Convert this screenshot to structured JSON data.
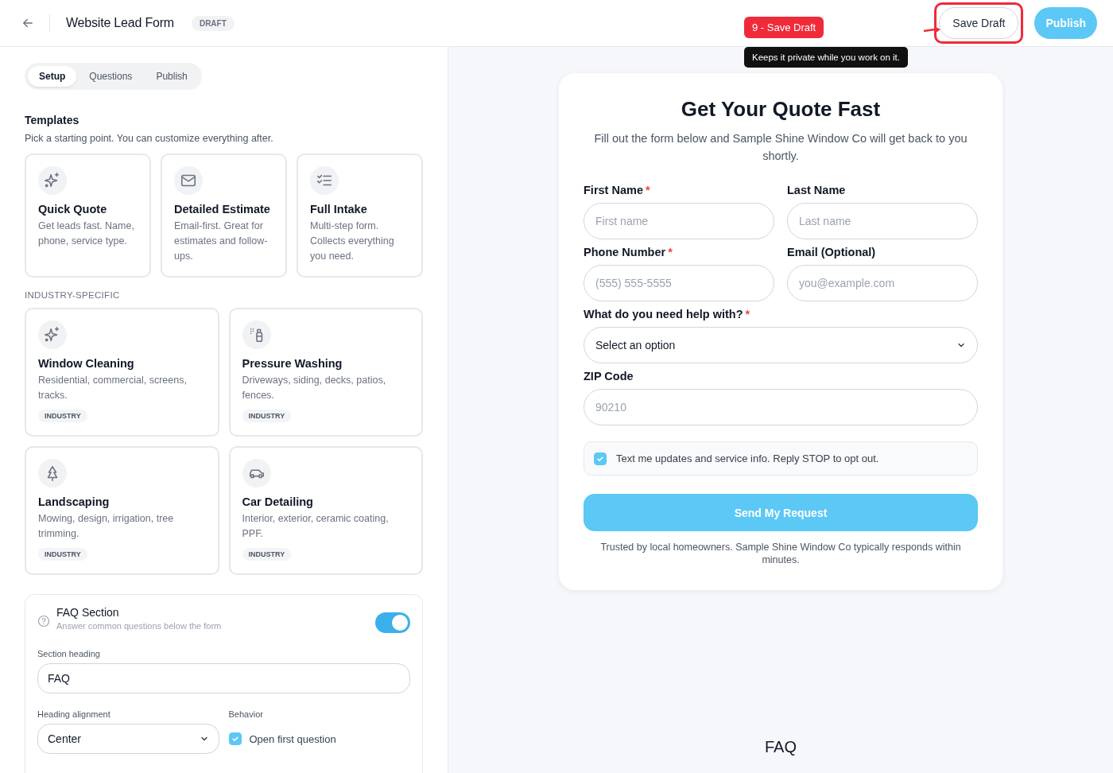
{
  "header": {
    "title": "Website Lead Form",
    "status": "DRAFT",
    "save_label": "Save Draft",
    "publish_label": "Publish"
  },
  "annotation": {
    "badge": "9 - Save Draft",
    "tooltip": "Keeps it private while you work on it."
  },
  "tabs": [
    {
      "label": "Setup",
      "selected": true
    },
    {
      "label": "Questions",
      "selected": false
    },
    {
      "label": "Publish",
      "selected": false
    }
  ],
  "templates": {
    "title": "Templates",
    "subtitle": "Pick a starting point. You can customize everything after.",
    "items": [
      {
        "title": "Quick Quote",
        "description": "Get leads fast. Name, phone, service type."
      },
      {
        "title": "Detailed Estimate",
        "description": "Email-first. Great for estimates and follow-ups."
      },
      {
        "title": "Full Intake",
        "description": "Multi-step form. Collects everything you need."
      }
    ]
  },
  "industry": {
    "title": "INDUSTRY-SPECIFIC",
    "items": [
      {
        "title": "Window Cleaning",
        "description": "Residential, commercial, screens, tracks.",
        "tag": "INDUSTRY"
      },
      {
        "title": "Pressure Washing",
        "description": "Driveways, siding, decks, patios, fences.",
        "tag": "INDUSTRY"
      },
      {
        "title": "Landscaping",
        "description": "Mowing, design, irrigation, tree trimming.",
        "tag": "INDUSTRY"
      },
      {
        "title": "Car Detailing",
        "description": "Interior, exterior, ceramic coating, PPF.",
        "tag": "INDUSTRY"
      }
    ]
  },
  "faq_settings": {
    "title": "FAQ Section",
    "subtitle": "Answer common questions below the form",
    "on": true,
    "heading_label": "Section heading",
    "heading_value": "FAQ",
    "alignment_label": "Heading alignment",
    "alignment_value": "Center",
    "behavior_label": "Behavior",
    "open_first": {
      "label": "Open first question",
      "checked": true
    }
  },
  "preview": {
    "title": "Get Your Quote Fast",
    "subtitle": "Fill out the form below and Sample Shine Window Co will get back to you shortly.",
    "fields": [
      {
        "kind": "text",
        "label": "First Name",
        "required": true,
        "placeholder": "First name"
      },
      {
        "kind": "text",
        "label": "Last Name",
        "required": false,
        "placeholder": "Last name"
      },
      {
        "kind": "text",
        "label": "Phone Number",
        "required": true,
        "placeholder": "(555) 555-5555"
      },
      {
        "kind": "text",
        "label": "Email (Optional)",
        "required": false,
        "placeholder": "you@example.com"
      },
      {
        "kind": "select",
        "label": "What do you need help with?",
        "required": true,
        "value": "Select an option"
      },
      {
        "kind": "wide",
        "label": "ZIP Code",
        "required": false,
        "placeholder": "90210"
      }
    ],
    "consent": {
      "label": "Text me updates and service info. Reply STOP to opt out.",
      "checked": true
    },
    "submit": "Send My Request",
    "footnote": "Trusted by local homeowners. Sample Shine Window Co typically responds within minutes.",
    "faq_heading": "FAQ",
    "required_mark": "*"
  }
}
